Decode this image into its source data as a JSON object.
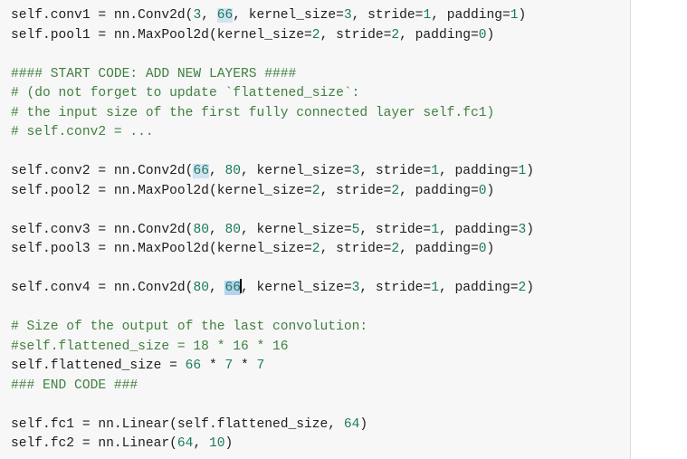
{
  "editor": {
    "lines": [
      [
        {
          "t": "self.conv1 = nn.Conv2d(",
          "c": "kw"
        },
        {
          "t": "3",
          "c": "num"
        },
        {
          "t": ", ",
          "c": "kw"
        },
        {
          "t": "66",
          "c": "num",
          "hl": "hl"
        },
        {
          "t": ", kernel_size=",
          "c": "kw"
        },
        {
          "t": "3",
          "c": "num"
        },
        {
          "t": ", stride=",
          "c": "kw"
        },
        {
          "t": "1",
          "c": "num"
        },
        {
          "t": ", padding=",
          "c": "kw"
        },
        {
          "t": "1",
          "c": "num"
        },
        {
          "t": ")",
          "c": "kw"
        }
      ],
      [
        {
          "t": "self.pool1 = nn.MaxPool2d(kernel_size=",
          "c": "kw"
        },
        {
          "t": "2",
          "c": "num"
        },
        {
          "t": ", stride=",
          "c": "kw"
        },
        {
          "t": "2",
          "c": "num"
        },
        {
          "t": ", padding=",
          "c": "kw"
        },
        {
          "t": "0",
          "c": "num"
        },
        {
          "t": ")",
          "c": "kw"
        }
      ],
      [],
      [
        {
          "t": "#### START CODE: ADD NEW LAYERS ####",
          "c": "com"
        }
      ],
      [
        {
          "t": "# (do not forget to update `flattened_size`:",
          "c": "com"
        }
      ],
      [
        {
          "t": "# the input size of the first fully connected layer self.fc1)",
          "c": "com"
        }
      ],
      [
        {
          "t": "# self.conv2 = ...",
          "c": "com"
        }
      ],
      [],
      [
        {
          "t": "self.conv2 = nn.Conv2d(",
          "c": "kw"
        },
        {
          "t": "66",
          "c": "num",
          "hl": "hl"
        },
        {
          "t": ", ",
          "c": "kw"
        },
        {
          "t": "80",
          "c": "num"
        },
        {
          "t": ", kernel_size=",
          "c": "kw"
        },
        {
          "t": "3",
          "c": "num"
        },
        {
          "t": ", stride=",
          "c": "kw"
        },
        {
          "t": "1",
          "c": "num"
        },
        {
          "t": ", padding=",
          "c": "kw"
        },
        {
          "t": "1",
          "c": "num"
        },
        {
          "t": ")",
          "c": "kw"
        }
      ],
      [
        {
          "t": "self.pool2 = nn.MaxPool2d(kernel_size=",
          "c": "kw"
        },
        {
          "t": "2",
          "c": "num"
        },
        {
          "t": ", stride=",
          "c": "kw"
        },
        {
          "t": "2",
          "c": "num"
        },
        {
          "t": ", padding=",
          "c": "kw"
        },
        {
          "t": "0",
          "c": "num"
        },
        {
          "t": ")",
          "c": "kw"
        }
      ],
      [],
      [
        {
          "t": "self.conv3 = nn.Conv2d(",
          "c": "kw"
        },
        {
          "t": "80",
          "c": "num"
        },
        {
          "t": ", ",
          "c": "kw"
        },
        {
          "t": "80",
          "c": "num"
        },
        {
          "t": ", kernel_size=",
          "c": "kw"
        },
        {
          "t": "5",
          "c": "num"
        },
        {
          "t": ", stride=",
          "c": "kw"
        },
        {
          "t": "1",
          "c": "num"
        },
        {
          "t": ", padding=",
          "c": "kw"
        },
        {
          "t": "3",
          "c": "num"
        },
        {
          "t": ")",
          "c": "kw"
        }
      ],
      [
        {
          "t": "self.pool3 = nn.MaxPool2d(kernel_size=",
          "c": "kw"
        },
        {
          "t": "2",
          "c": "num"
        },
        {
          "t": ", stride=",
          "c": "kw"
        },
        {
          "t": "2",
          "c": "num"
        },
        {
          "t": ", padding=",
          "c": "kw"
        },
        {
          "t": "0",
          "c": "num"
        },
        {
          "t": ")",
          "c": "kw"
        }
      ],
      [],
      [
        {
          "t": "self.conv4 = nn.Conv2d(",
          "c": "kw"
        },
        {
          "t": "80",
          "c": "num"
        },
        {
          "t": ", ",
          "c": "kw"
        },
        {
          "t": "66",
          "c": "num",
          "hl": "hlsel"
        },
        {
          "t": "",
          "caret": true
        },
        {
          "t": ", kernel_size=",
          "c": "kw"
        },
        {
          "t": "3",
          "c": "num"
        },
        {
          "t": ", stride=",
          "c": "kw"
        },
        {
          "t": "1",
          "c": "num"
        },
        {
          "t": ", padding=",
          "c": "kw"
        },
        {
          "t": "2",
          "c": "num"
        },
        {
          "t": ")",
          "c": "kw"
        }
      ],
      [],
      [
        {
          "t": "# Size of the output of the last convolution:",
          "c": "com"
        }
      ],
      [
        {
          "t": "#self.flattened_size = 18 * 16 * 16",
          "c": "com"
        }
      ],
      [
        {
          "t": "self.flattened_size = ",
          "c": "kw"
        },
        {
          "t": "66",
          "c": "num"
        },
        {
          "t": " * ",
          "c": "kw"
        },
        {
          "t": "7",
          "c": "num"
        },
        {
          "t": " * ",
          "c": "kw"
        },
        {
          "t": "7",
          "c": "num"
        }
      ],
      [
        {
          "t": "### END CODE ###",
          "c": "com"
        }
      ],
      [],
      [
        {
          "t": "self.fc1 = nn.Linear(self.flattened_size, ",
          "c": "kw"
        },
        {
          "t": "64",
          "c": "num"
        },
        {
          "t": ")",
          "c": "kw"
        }
      ],
      [
        {
          "t": "self.fc2 = nn.Linear(",
          "c": "kw"
        },
        {
          "t": "64",
          "c": "num"
        },
        {
          "t": ", ",
          "c": "kw"
        },
        {
          "t": "10",
          "c": "num"
        },
        {
          "t": ")",
          "c": "kw"
        }
      ]
    ]
  },
  "colors": {
    "background": "#f7f7f7",
    "text": "#202020",
    "number": "#1a7a5e",
    "comment": "#408040",
    "match_highlight": "#d2e3f3",
    "selected_highlight": "#b6d3ee"
  }
}
